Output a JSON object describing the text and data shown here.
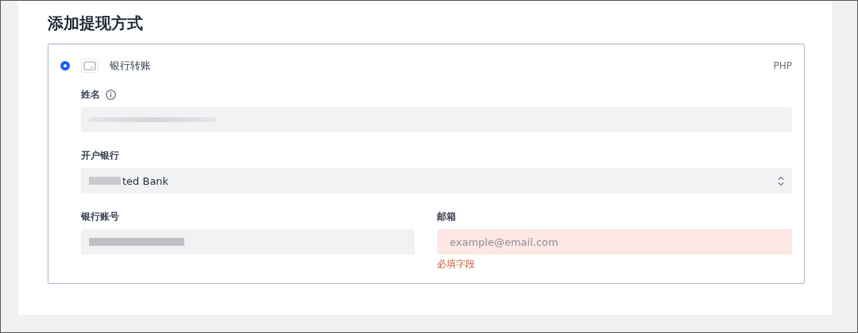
{
  "title": "添加提现方式",
  "method": {
    "label": "银行转账",
    "currency": "PHP",
    "selected": true
  },
  "fields": [
    {
      "kind": "text",
      "label": "姓名",
      "info": true,
      "redacted": true
    },
    {
      "kind": "select",
      "label": "开户银行",
      "value": "ted Bank",
      "redacted": true
    },
    {
      "kind": "text",
      "label": "银行账号",
      "redacted": true,
      "half": true
    },
    {
      "kind": "email",
      "label": "邮箱",
      "placeholder": "example@email.com",
      "error": "必填字段",
      "half": true
    }
  ]
}
